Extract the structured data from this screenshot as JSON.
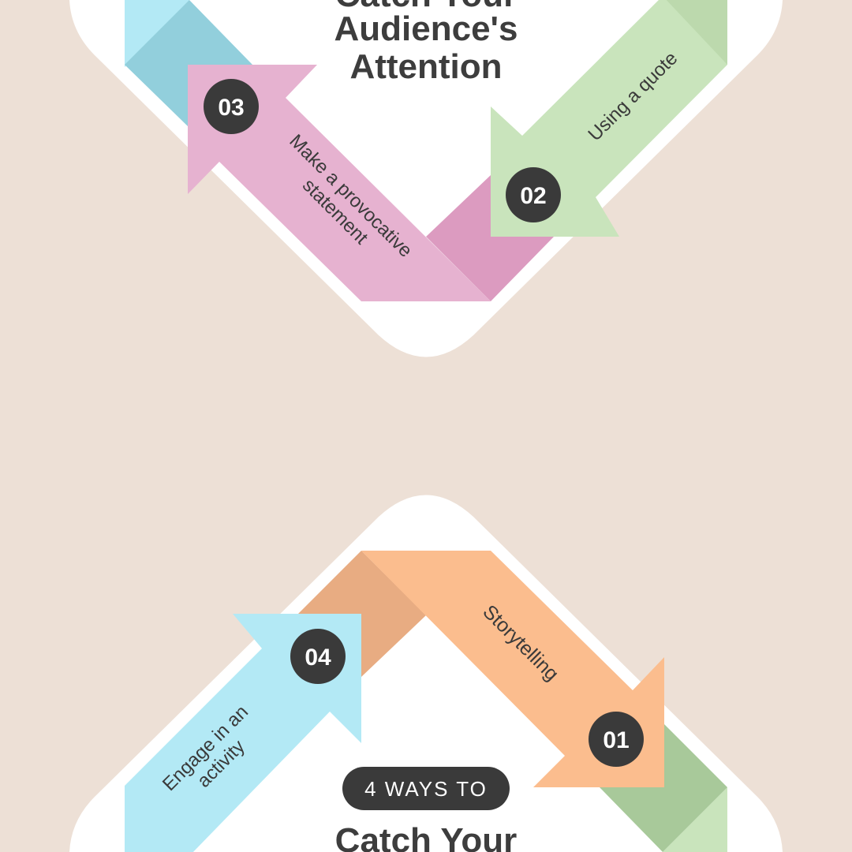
{
  "heading": {
    "eyebrow": "4 WAYS TO",
    "top_line1": "Catch Your",
    "top_line2": "Audience's",
    "top_line3": "Attention",
    "bottom_line1": "Catch Your"
  },
  "steps": [
    {
      "number": "01",
      "label": "Storytelling",
      "color": "#fbbd8e"
    },
    {
      "number": "02",
      "label": "Using a quote",
      "color": "#c9e4bc"
    },
    {
      "number": "03",
      "label_line1": "Make a provocative",
      "label_line2": "statement",
      "color": "#e6b2d0"
    },
    {
      "number": "04",
      "label_line1": "Engage in an",
      "label_line2": "activity",
      "color": "#b3e9f5"
    }
  ],
  "colors": {
    "background": "#ede0d6",
    "card": "#ffffff",
    "badge": "#3a3a3a",
    "text": "#3d3d3d"
  }
}
